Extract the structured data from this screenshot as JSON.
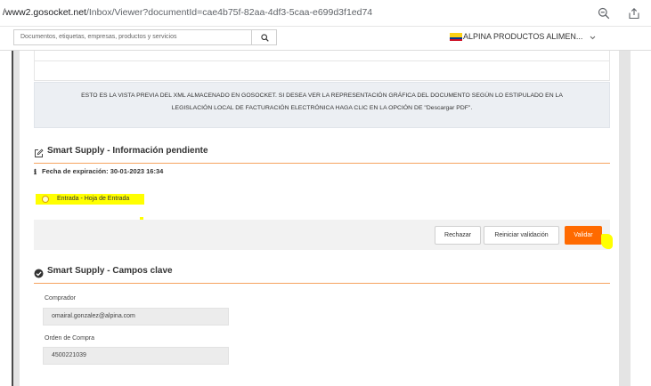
{
  "browser": {
    "url_domain": "/www2.gosocket.net",
    "url_path": "/Inbox/Viewer?documentId=cae4b75f-82aa-4df3-5caa-e699d3f1ed74",
    "icons": [
      "zoom-out-icon",
      "share-icon"
    ]
  },
  "header": {
    "search_placeholder": "Documentos, etiquetas, empresas, productos y servicios",
    "search_icon": "search-icon",
    "company_flag": "colombia-flag",
    "company_name": "ALPINA PRODUCTOS ALIMEN...",
    "company_chevron": "chevron-down-icon"
  },
  "notice": {
    "line1": "ESTO ES LA VISTA PREVIA DEL XML ALMACENADO EN GOSOCKET. SI DESEA VER LA REPRESENTACIÓN GRÁFICA DEL DOCUMENTO SEGÚN LO ESTIPULADO EN LA",
    "line2": "LEGISLACIÓN LOCAL DE FACTURACIÓN ELECTRÓNICA HAGA CLIC EN LA OPCIÓN DE \"Descargar PDF\"."
  },
  "pending": {
    "icon": "edit-icon",
    "title": "Smart Supply - Información pendiente",
    "expiration_icon": "info-icon",
    "expiration": "Fecha de expiración: 30-01-2023 16:34",
    "option": "Entrada - Hoja de Entrada",
    "buttons": {
      "reject": "Rechazar",
      "reset": "Reiniciar validación",
      "validate": "Validar"
    }
  },
  "key_fields": {
    "icon": "check-circle-icon",
    "title": "Smart Supply - Campos clave",
    "fields": [
      {
        "label": "Comprador",
        "value": "omairal.gonzalez@alpina.com"
      },
      {
        "label": "Orden de Compra",
        "value": "4500221039"
      }
    ]
  },
  "colors": {
    "accent": "#ff6a00",
    "accent_line": "#f6a35f",
    "highlight": "#ffff00"
  }
}
